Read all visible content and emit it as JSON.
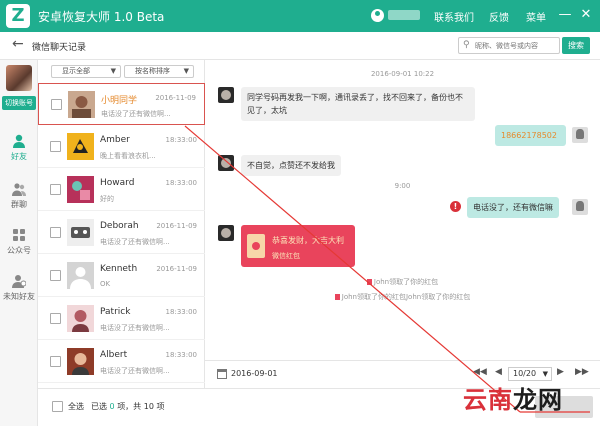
{
  "app": {
    "title": "安卓恢复大师 1.0 Beta",
    "user_name": "*****"
  },
  "titlebar": {
    "contact_us": "联系我们",
    "feedback": "反馈",
    "menu": "菜单",
    "minimize": "—",
    "close": "✕"
  },
  "header": {
    "title": "微信聊天记录",
    "search_placeholder": "昵称、微信号或内容",
    "search_button": "搜索"
  },
  "leftnav": {
    "switch_account": "切换账号",
    "items": [
      {
        "label": "好友",
        "icon": "person-icon",
        "active": true
      },
      {
        "label": "群聊",
        "icon": "group-icon",
        "active": false
      },
      {
        "label": "公众号",
        "icon": "grid-icon",
        "active": false
      },
      {
        "label": "未知好友",
        "icon": "unknown-person-icon",
        "active": false
      }
    ]
  },
  "filters": {
    "show": "显示全部",
    "sort": "按名称排序"
  },
  "contacts": [
    {
      "name": "小明同学",
      "time": "2016-11-09",
      "message": "电话没了还有微信啊...",
      "selected": true
    },
    {
      "name": "Amber",
      "time": "18:33:00",
      "message": "晚上看看浪衣机...",
      "selected": false
    },
    {
      "name": "Howard",
      "time": "18:33:00",
      "message": "好的",
      "selected": false
    },
    {
      "name": "Deborah",
      "time": "2016-11-09",
      "message": "电话没了还有微信啊...",
      "selected": false
    },
    {
      "name": "Kenneth",
      "time": "2016-11-09",
      "message": "OK",
      "selected": false
    },
    {
      "name": "Patrick",
      "time": "18:33:00",
      "message": "电话没了还有微信啊...",
      "selected": false
    },
    {
      "name": "Albert",
      "time": "18:33:00",
      "message": "电话没了还有微信啊...",
      "selected": false
    }
  ],
  "bottombar": {
    "select_all": "全选",
    "selected_prefix": "已选",
    "selected_count": "0",
    "selected_mid": "项，共",
    "total_count": "10",
    "selected_suffix": "项"
  },
  "chat": {
    "timestamp1": "2016-09-01 10:22",
    "msg1_line1": "同学号码再发我一下啊，通讯录丢了，找不回来了，备份也不",
    "msg1_line2": "见了，太坑",
    "msg2": "18662178502",
    "msg3": "不自觉，点赞还不发给我",
    "timestamp2": "9:00",
    "msg4": "电话没了，还有微信嘛",
    "redpacket_title": "恭喜发财，大吉大利",
    "redpacket_sub": "微信红包",
    "sys1": "John领取了你的红包",
    "sys2": "John领取了你的红包John领取了你的红包",
    "error_mark": "!"
  },
  "chatfoot": {
    "date": "2016-09-01",
    "page": "10/20"
  },
  "watermark": {
    "part1": "云南",
    "part2": "龙网"
  },
  "colors": {
    "brand": "#1fae8f",
    "selected_border": "#d9534f",
    "redpacket": "#e9445c",
    "error": "#d9313a"
  }
}
